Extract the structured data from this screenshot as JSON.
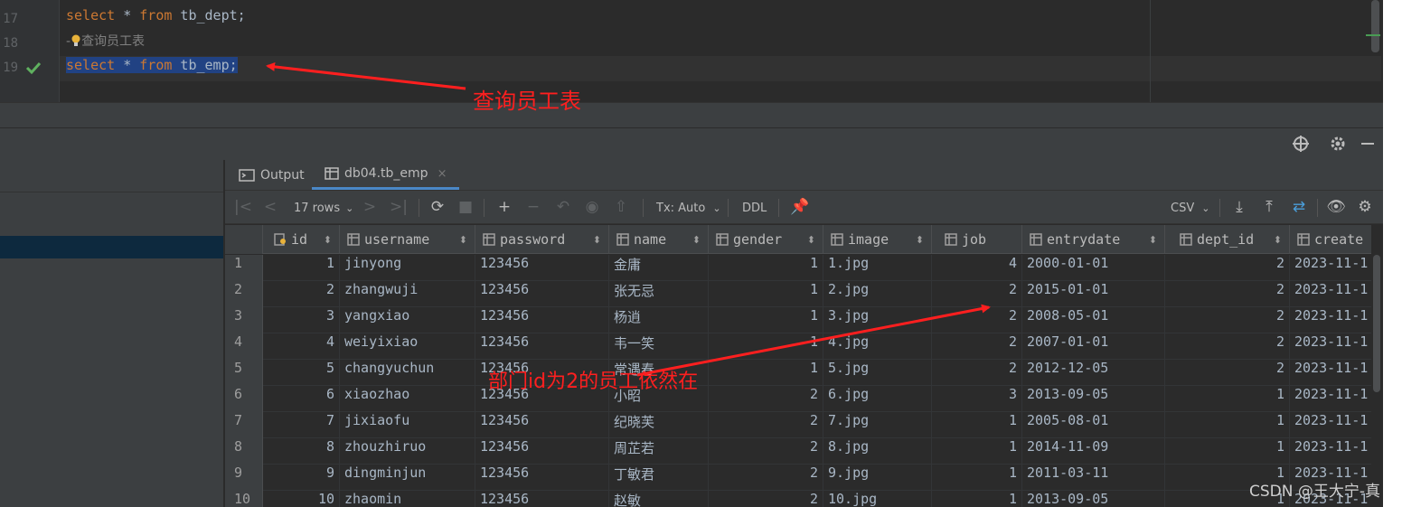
{
  "editor": {
    "lines": [
      {
        "number": "17",
        "code_kw1": "select",
        "code_star": " * ",
        "code_kw2": "from",
        "code_rest": " tb_dept;"
      },
      {
        "number": "18",
        "comment_prefix": "-",
        "comment": "查询员工表"
      },
      {
        "number": "19",
        "code_kw1": "select",
        "code_star": " * ",
        "code_kw2": "from",
        "code_rest": " tb_emp;"
      }
    ]
  },
  "tabs": [
    {
      "label": "Output",
      "icon": "console-icon"
    },
    {
      "label": "db04.tb_emp",
      "icon": "table-icon",
      "close": "×"
    }
  ],
  "toolbar": {
    "rows_label": "17 rows",
    "tx_label": "Tx: Auto",
    "ddl_label": "DDL",
    "export_format": "CSV"
  },
  "grid": {
    "columns": [
      "id",
      "username",
      "password",
      "name",
      "gender",
      "image",
      "job",
      "entrydate",
      "dept_id",
      "create"
    ],
    "sort_glyph": "⬍",
    "rows": [
      [
        "1",
        "1",
        "jinyong",
        "123456",
        "金庸",
        "1",
        "1.jpg",
        "4",
        "2000-01-01",
        "2",
        "2023-11-1"
      ],
      [
        "2",
        "2",
        "zhangwuji",
        "123456",
        "张无忌",
        "1",
        "2.jpg",
        "2",
        "2015-01-01",
        "2",
        "2023-11-1"
      ],
      [
        "3",
        "3",
        "yangxiao",
        "123456",
        "杨逍",
        "1",
        "3.jpg",
        "2",
        "2008-05-01",
        "2",
        "2023-11-1"
      ],
      [
        "4",
        "4",
        "weiyixiao",
        "123456",
        "韦一笑",
        "1",
        "4.jpg",
        "2",
        "2007-01-01",
        "2",
        "2023-11-1"
      ],
      [
        "5",
        "5",
        "changyuchun",
        "123456",
        "常遇春",
        "1",
        "5.jpg",
        "2",
        "2012-12-05",
        "2",
        "2023-11-1"
      ],
      [
        "6",
        "6",
        "xiaozhao",
        "123456",
        "小昭",
        "2",
        "6.jpg",
        "3",
        "2013-09-05",
        "1",
        "2023-11-1"
      ],
      [
        "7",
        "7",
        "jixiaofu",
        "123456",
        "纪晓芙",
        "2",
        "7.jpg",
        "1",
        "2005-08-01",
        "1",
        "2023-11-1"
      ],
      [
        "8",
        "8",
        "zhouzhiruo",
        "123456",
        "周芷若",
        "2",
        "8.jpg",
        "1",
        "2014-11-09",
        "1",
        "2023-11-1"
      ],
      [
        "9",
        "9",
        "dingminjun",
        "123456",
        "丁敏君",
        "2",
        "9.jpg",
        "1",
        "2011-03-11",
        "1",
        "2023-11-1"
      ],
      [
        "10",
        "10",
        "zhaomin",
        "123456",
        "赵敏",
        "2",
        "10.jpg",
        "1",
        "2013-09-05",
        "1",
        "2023-11-1"
      ]
    ]
  },
  "annotations": {
    "query_label": "查询员工表",
    "dept_label": "部门id为2的员工依然在",
    "color": "#ff1f1f"
  },
  "watermark": "CSDN @王大宁-真"
}
